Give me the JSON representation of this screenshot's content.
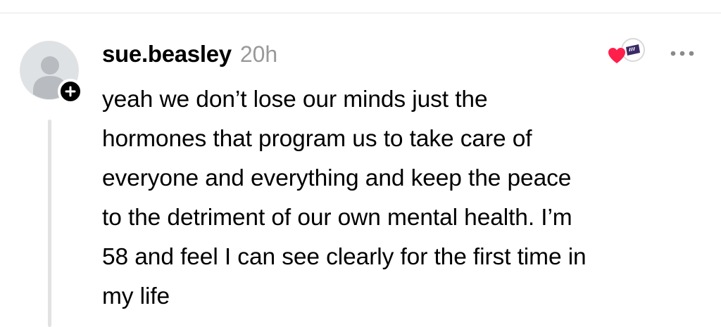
{
  "comment": {
    "username": "sue.beasley",
    "timestamp": "20h",
    "lines": [
      "yeah we don’t lose our minds just the",
      "hormones that program us to take care of",
      "everyone and everything and keep the peace",
      "to the detriment of our own mental health. I’m",
      "58 and feel I can see clearly for the first time in",
      "my life"
    ]
  },
  "icons": {
    "avatar": "default-person-avatar",
    "follow": "plus-icon",
    "reaction": "heart-icon",
    "author_badge": "creator-badge-icon",
    "more": "more-horizontal-icon"
  },
  "colors": {
    "heart": "#ff1f4b",
    "timestamp": "#999999",
    "thread_line": "#e2e2e2",
    "avatar_bg": "#dfe2e5",
    "avatar_figure": "#b8bcc1"
  }
}
